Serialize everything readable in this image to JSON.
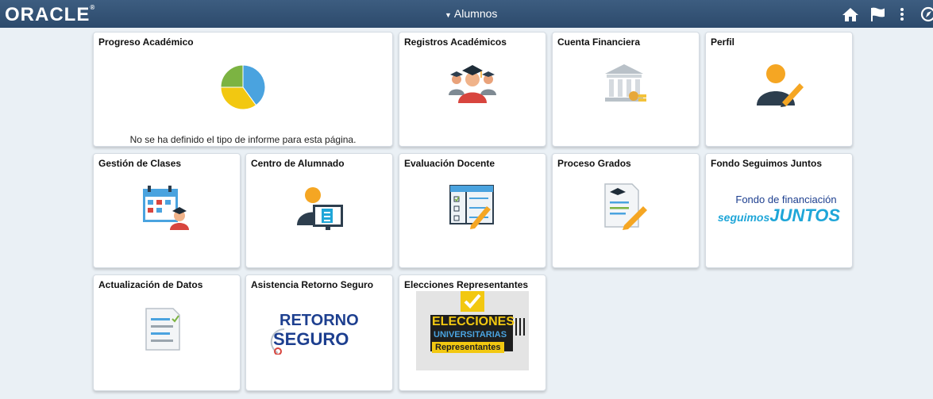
{
  "header": {
    "logo": "ORACLE",
    "logo_mark": "®",
    "homepage_label": "Alumnos",
    "homepage_caret": "▼",
    "icons": [
      "home-icon",
      "flag-icon",
      "more-options-icon",
      "navbar-icon"
    ]
  },
  "tiles": {
    "progreso": {
      "title": "Progreso Académico",
      "message": "No se ha definido el tipo de informe para esta página."
    },
    "registros": {
      "title": "Registros Académicos"
    },
    "cuenta": {
      "title": "Cuenta Financiera"
    },
    "perfil": {
      "title": "Perfil"
    },
    "gestion": {
      "title": "Gestión de Clases"
    },
    "centro": {
      "title": "Centro de Alumnado"
    },
    "evaluacion": {
      "title": "Evaluación Docente"
    },
    "proceso": {
      "title": "Proceso Grados"
    },
    "fondo": {
      "title": "Fondo Seguimos Juntos",
      "logo_line1": "Fondo de financiación",
      "logo_word1": "seguimos",
      "logo_word2": "JUNTOS"
    },
    "actualizacion": {
      "title": "Actualización de Datos"
    },
    "asistencia": {
      "title": "Asistencia Retorno Seguro",
      "logo_line1": "RETORNO",
      "logo_line2": "SEGURO"
    },
    "elecciones": {
      "title": "Elecciones Representantes",
      "banner_line1": "ELECCIONES",
      "banner_line2": "UNIVERSITARIAS",
      "banner_line3": "Representantes"
    }
  },
  "colors": {
    "header_bg": "#2c4a6c",
    "page_bg": "#eaf0f5",
    "tile_bg": "#ffffff",
    "chart_blue": "#4aa3df",
    "chart_yellow": "#f2c811",
    "chart_green": "#7cb342",
    "accent_orange": "#f5a623",
    "avatar_dark": "#2d3e4e",
    "fondo_blue": "#1fa6d8",
    "retorno_blue": "#1d3f8f"
  },
  "chart_data": {
    "type": "pie",
    "values": [
      40,
      35,
      25
    ],
    "colors": [
      "#4aa3df",
      "#f2c811",
      "#7cb342"
    ]
  }
}
